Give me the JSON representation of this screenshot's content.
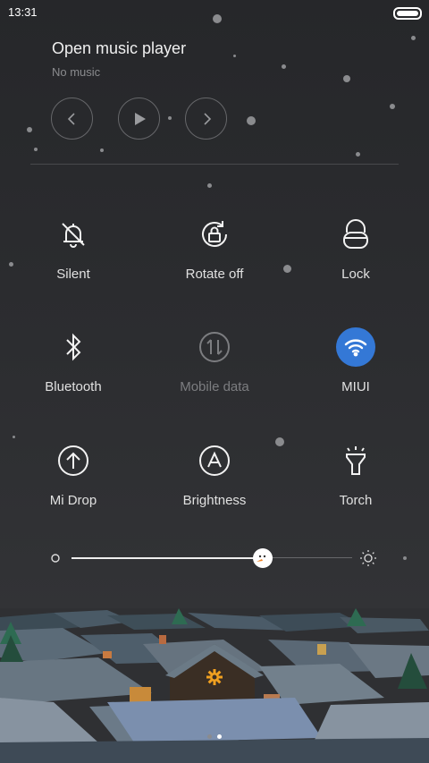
{
  "status": {
    "time": "13:31"
  },
  "music": {
    "title": "Open music player",
    "subtitle": "No music"
  },
  "tiles": [
    {
      "label": "Silent",
      "icon": "bell-off-icon",
      "active": false,
      "disabled": false
    },
    {
      "label": "Rotate off",
      "icon": "rotate-lock-icon",
      "active": false,
      "disabled": false
    },
    {
      "label": "Lock",
      "icon": "lock-icon",
      "active": false,
      "disabled": false
    },
    {
      "label": "Bluetooth",
      "icon": "bluetooth-icon",
      "active": false,
      "disabled": false
    },
    {
      "label": "Mobile data",
      "icon": "mobile-data-icon",
      "active": false,
      "disabled": true
    },
    {
      "label": "MIUI",
      "icon": "wifi-icon",
      "active": true,
      "disabled": false
    },
    {
      "label": "Mi Drop",
      "icon": "upload-icon",
      "active": false,
      "disabled": false
    },
    {
      "label": "Brightness",
      "icon": "auto-brightness-icon",
      "active": false,
      "disabled": false
    },
    {
      "label": "Torch",
      "icon": "flashlight-icon",
      "active": false,
      "disabled": false
    }
  ],
  "brightness": {
    "level": 0.68
  },
  "pager": {
    "pages": 2,
    "current": 2
  },
  "colors": {
    "accent": "#3478d6",
    "background": "#2a2b2e",
    "window_glow": "#f0a020"
  }
}
